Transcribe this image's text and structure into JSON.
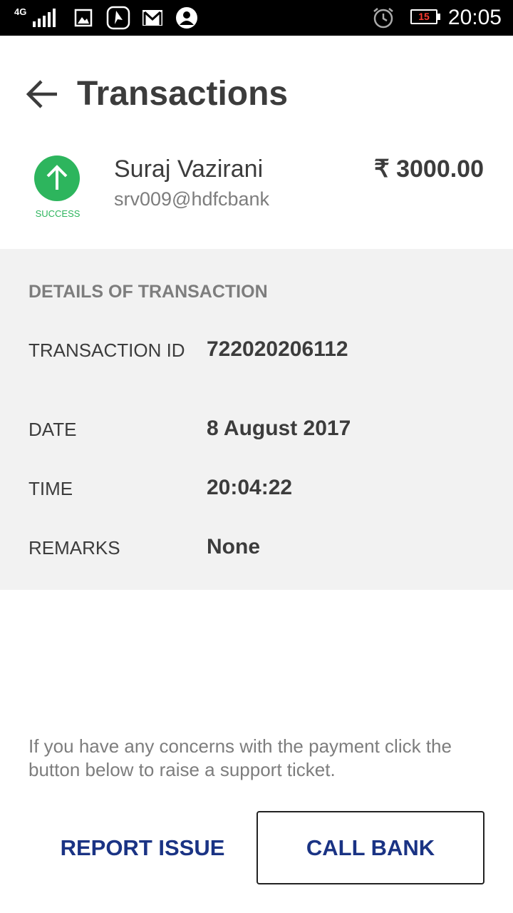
{
  "status_bar": {
    "network": "4G",
    "battery_level": "15",
    "clock": "20:05",
    "icons": [
      "signal-icon",
      "gallery-icon",
      "app-icon",
      "gmail-icon",
      "profile-icon",
      "alarm-icon",
      "battery-icon"
    ]
  },
  "header": {
    "title": "Transactions"
  },
  "transaction": {
    "status": "SUCCESS",
    "status_color": "#2db55d",
    "payee_name": "Suraj Vazirani",
    "payee_vpa": "srv009@hdfcbank",
    "amount": "₹ 3000.00"
  },
  "details": {
    "heading": "DETAILS OF TRANSACTION",
    "rows": [
      {
        "label": "TRANSACTION ID",
        "value": "722020206112"
      },
      {
        "label": "DATE",
        "value": "8 August 2017"
      },
      {
        "label": "TIME",
        "value": "20:04:22"
      },
      {
        "label": "REMARKS",
        "value": "None"
      }
    ]
  },
  "footer": {
    "concern_text": "If you have any concerns with the payment click the button below to raise a support ticket.",
    "report_label": "REPORT ISSUE",
    "call_label": "CALL BANK",
    "button_text_color": "#1a3384"
  }
}
